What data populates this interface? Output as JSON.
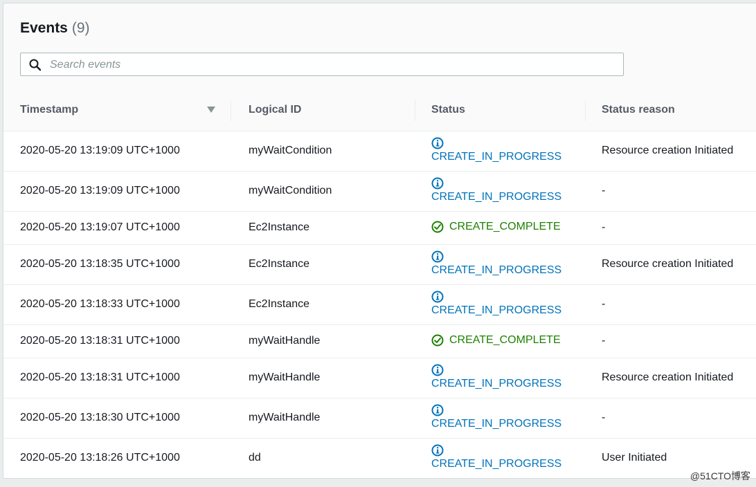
{
  "header": {
    "title": "Events",
    "count": "(9)"
  },
  "search": {
    "placeholder": "Search events",
    "value": ""
  },
  "columns": {
    "timestamp": "Timestamp",
    "logical_id": "Logical ID",
    "status": "Status",
    "status_reason": "Status reason"
  },
  "colors": {
    "in_progress": "#0073bb",
    "complete": "#1d8102"
  },
  "rows": [
    {
      "timestamp": "2020-05-20 13:19:09 UTC+1000",
      "logical_id": "myWaitCondition",
      "status": "CREATE_IN_PROGRESS",
      "status_icon": "info-icon",
      "reason": "Resource creation Initiated"
    },
    {
      "timestamp": "2020-05-20 13:19:09 UTC+1000",
      "logical_id": "myWaitCondition",
      "status": "CREATE_IN_PROGRESS",
      "status_icon": "info-icon",
      "reason": "-"
    },
    {
      "timestamp": "2020-05-20 13:19:07 UTC+1000",
      "logical_id": "Ec2Instance",
      "status": "CREATE_COMPLETE",
      "status_icon": "check-circle-icon",
      "reason": "-"
    },
    {
      "timestamp": "2020-05-20 13:18:35 UTC+1000",
      "logical_id": "Ec2Instance",
      "status": "CREATE_IN_PROGRESS",
      "status_icon": "info-icon",
      "reason": "Resource creation Initiated"
    },
    {
      "timestamp": "2020-05-20 13:18:33 UTC+1000",
      "logical_id": "Ec2Instance",
      "status": "CREATE_IN_PROGRESS",
      "status_icon": "info-icon",
      "reason": "-"
    },
    {
      "timestamp": "2020-05-20 13:18:31 UTC+1000",
      "logical_id": "myWaitHandle",
      "status": "CREATE_COMPLETE",
      "status_icon": "check-circle-icon",
      "reason": "-"
    },
    {
      "timestamp": "2020-05-20 13:18:31 UTC+1000",
      "logical_id": "myWaitHandle",
      "status": "CREATE_IN_PROGRESS",
      "status_icon": "info-icon",
      "reason": "Resource creation Initiated"
    },
    {
      "timestamp": "2020-05-20 13:18:30 UTC+1000",
      "logical_id": "myWaitHandle",
      "status": "CREATE_IN_PROGRESS",
      "status_icon": "info-icon",
      "reason": "-"
    },
    {
      "timestamp": "2020-05-20 13:18:26 UTC+1000",
      "logical_id": "dd",
      "status": "CREATE_IN_PROGRESS",
      "status_icon": "info-icon",
      "reason": "User Initiated"
    }
  ],
  "watermark": "@51CTO博客"
}
